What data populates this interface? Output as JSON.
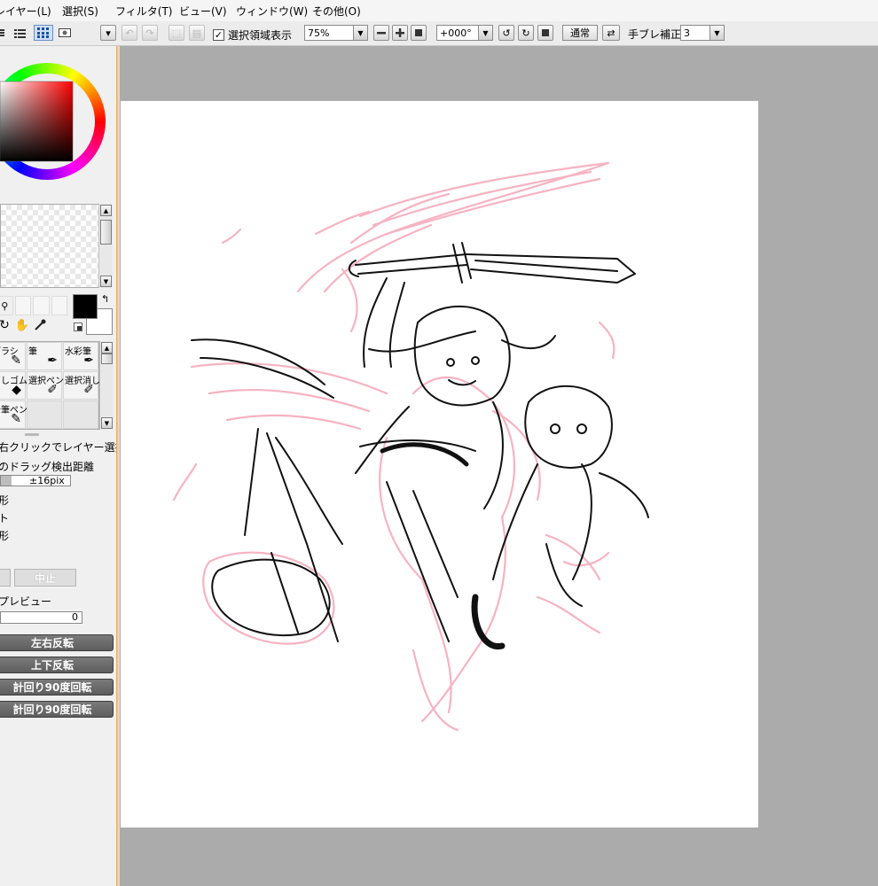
{
  "menu": {
    "items": [
      "レイヤー(L)",
      "選択(S)",
      "フィルタ(T)",
      "ビュー(V)",
      "ウィンドウ(W)",
      "その他(O)"
    ]
  },
  "toolbar": {
    "selection_display_label": "選択領域表示",
    "selection_display_checked": true,
    "zoom_value": "75%",
    "rotation_value": "+000°",
    "blend_mode_button": "通常",
    "stabilizer_label": "手ブレ補正",
    "stabilizer_value": "3"
  },
  "left_panel": {
    "brush_tools": [
      {
        "label": "ブラシ",
        "icon": "brush-icon"
      },
      {
        "label": "筆",
        "icon": "pen-icon"
      },
      {
        "label": "水彩筆",
        "icon": "watercolor-icon"
      },
      {
        "label": "消しゴム",
        "icon": "eraser-icon"
      },
      {
        "label": "選択ペン",
        "icon": "select-pen-icon"
      },
      {
        "label": "選択消し",
        "icon": "select-erase-icon"
      },
      {
        "label": "鉛筆ペン",
        "icon": "pencil-icon"
      }
    ],
    "option_layer_select": "右クリックでレイヤー選択",
    "option_drag_detect": "のドラッグ検出距離",
    "drag_detect_value": "±16pix",
    "transform_option_1": "形",
    "transform_option_2": "ト",
    "transform_option_3": "形",
    "cancel_button": "中止",
    "preview_label": "プレビュー",
    "preview_value": "0",
    "flip_horizontal": "左右反転",
    "flip_vertical": "上下反転",
    "rotate_ccw": "計回り90度回転",
    "rotate_cw": "計回り90度回転",
    "primary_color": "#000000",
    "secondary_color": "#ffffff"
  },
  "colors": {
    "sketch_pink": "#f6b3c2",
    "line_black": "#111111",
    "canvas_bg": "#ababab",
    "accent_orange": "#e7a25a"
  }
}
